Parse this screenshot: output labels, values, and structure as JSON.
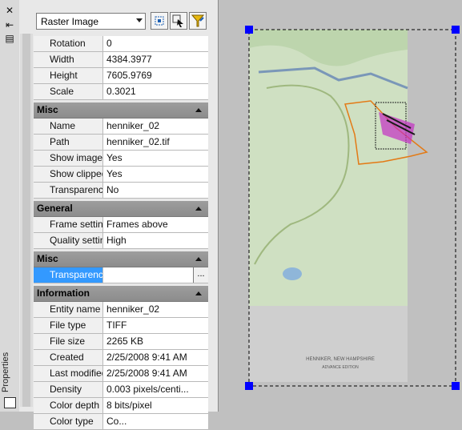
{
  "toolbar": {
    "object_type": "Raster Image"
  },
  "sidebar": {
    "title": "Properties"
  },
  "sections": {
    "misc1": "Misc",
    "general": "General",
    "misc2": "Misc",
    "information": "Information"
  },
  "rows": {
    "rotation": {
      "k": "Rotation",
      "v": "0"
    },
    "width": {
      "k": "Width",
      "v": "4384.3977"
    },
    "height": {
      "k": "Height",
      "v": "7605.9769"
    },
    "scale": {
      "k": "Scale",
      "v": "0.3021"
    },
    "name": {
      "k": "Name",
      "v": "henniker_02"
    },
    "path": {
      "k": "Path",
      "v": "henniker_02.tif"
    },
    "show_image": {
      "k": "Show image",
      "v": "Yes"
    },
    "show_clipped": {
      "k": "Show clipped",
      "v": "Yes"
    },
    "transparency": {
      "k": "Transparency",
      "v": "No"
    },
    "frame_setting": {
      "k": "Frame setting",
      "v": "Frames above"
    },
    "quality_setting": {
      "k": "Quality setting",
      "v": "High"
    },
    "transparency2": {
      "k": "Transparency ...",
      "v": ""
    },
    "entity_name": {
      "k": "Entity name",
      "v": "henniker_02"
    },
    "file_type": {
      "k": "File type",
      "v": "TIFF"
    },
    "file_size": {
      "k": "File size",
      "v": "2265 KB"
    },
    "created": {
      "k": "Created",
      "v": "2/25/2008 9:41 AM"
    },
    "last_modified": {
      "k": "Last modified",
      "v": "2/25/2008 9:41 AM"
    },
    "density": {
      "k": "Density",
      "v": "0.003 pixels/centi..."
    },
    "color_depth": {
      "k": "Color depth",
      "v": "8 bits/pixel"
    },
    "color_type": {
      "k": "Color type",
      "v": "Co..."
    }
  },
  "map_text": {
    "title": "HENNIKER, NEW HAMPSHIRE",
    "subtitle": "ADVANCE EDITION"
  }
}
